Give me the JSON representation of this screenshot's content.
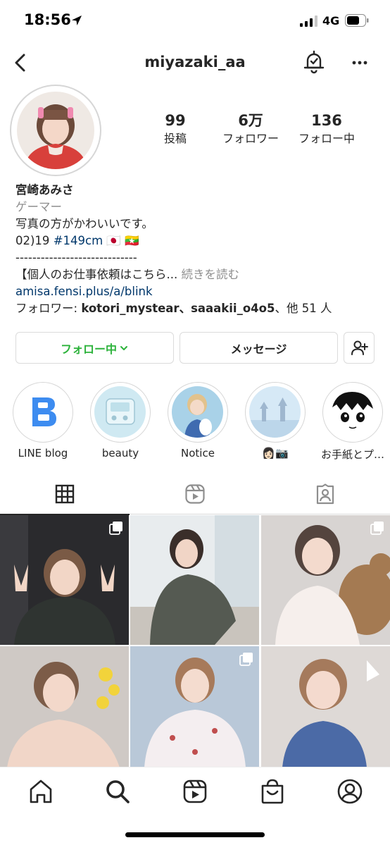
{
  "status_bar": {
    "time": "18:56",
    "network": "4G"
  },
  "header": {
    "username": "miyazaki_aa"
  },
  "stats": {
    "posts_count": "99",
    "posts_label": "投稿",
    "followers_count": "6万",
    "followers_label": "フォロワー",
    "following_count": "136",
    "following_label": "フォロー中"
  },
  "bio": {
    "name": "宮崎あみさ",
    "category": "ゲーマー",
    "line1": "写真の方がかわいいです。",
    "line2_prefix": "02)19 ",
    "hashtag": "#149cm",
    "line2_flags": " 🇯🇵 🇲🇲",
    "divider": "-----------------------------",
    "line3": "【個人のお仕事依頼はこちら...",
    "more": "続きを読む",
    "link": "amisa.fensi.plus/a/blink",
    "followed_by_prefix": "フォロワー: ",
    "followed_by_names": "kotori_mystear、saaakii_o4o5",
    "followed_by_suffix": "、他 51 人"
  },
  "actions": {
    "follow_label": "フォロー中",
    "message_label": "メッセージ"
  },
  "highlights": [
    {
      "label": "LINE blog"
    },
    {
      "label": "beauty"
    },
    {
      "label": "Notice"
    },
    {
      "label": "👩🏻📷"
    },
    {
      "label": "お手紙とプ…"
    }
  ],
  "colors": {
    "following_green": "#2db33c",
    "link_blue": "#00376b",
    "secondary_gray": "#8e8e8e",
    "line_blog_blue": "#3d8cf0"
  },
  "icons": {
    "back": "chevron-left-icon",
    "bell": "notification-bell-icon",
    "more": "more-horizontal-icon",
    "grid_tab": "grid-icon",
    "reels_tab": "reels-icon",
    "tagged_tab": "tagged-user-icon",
    "nav": [
      "home-icon",
      "search-icon",
      "reels-icon",
      "shop-icon",
      "profile-icon"
    ]
  }
}
